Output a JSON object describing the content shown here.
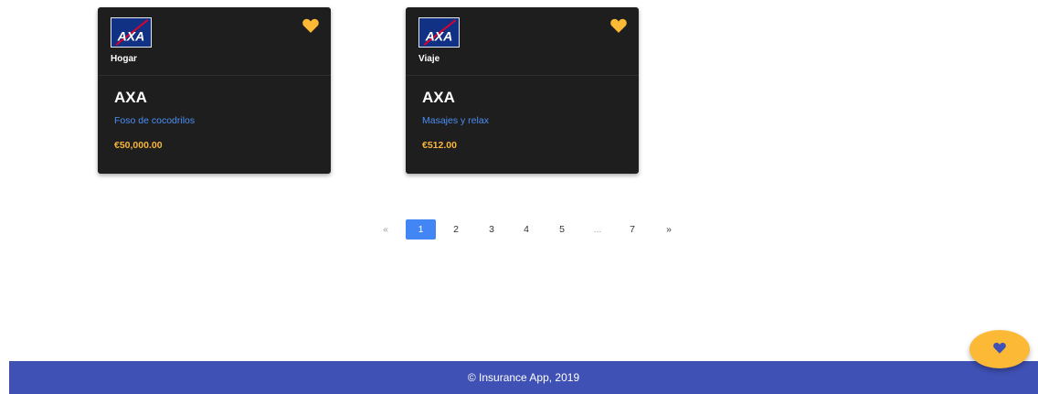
{
  "cards": [
    {
      "logo_icon": "axa-logo-icon",
      "category": "Hogar",
      "company": "AXA",
      "product": "Foso de cocodrilos",
      "price": "€50,000.00",
      "favorite_icon": "heart-icon"
    },
    {
      "logo_icon": "axa-logo-icon",
      "category": "Viaje",
      "company": "AXA",
      "product": "Masajes y relax",
      "price": "€512.00",
      "favorite_icon": "heart-icon"
    }
  ],
  "pagination": {
    "prev": "«",
    "pages": [
      "1",
      "2",
      "3",
      "4",
      "5",
      "...",
      "7"
    ],
    "active_page": "1",
    "next": "»"
  },
  "footer": {
    "text": "© Insurance App, 2019"
  },
  "fab": {
    "icon": "heart-icon"
  },
  "colors": {
    "card_bg": "#1e1e1e",
    "product_link": "#4a8ff5",
    "price": "#f6b53a",
    "heart": "#fbb936",
    "fab_heart": "#3f51b5",
    "pagination_active": "#4285f4",
    "footer_bg": "#3f51b5",
    "axa_blue": "#103184",
    "axa_red": "#e4002b"
  }
}
